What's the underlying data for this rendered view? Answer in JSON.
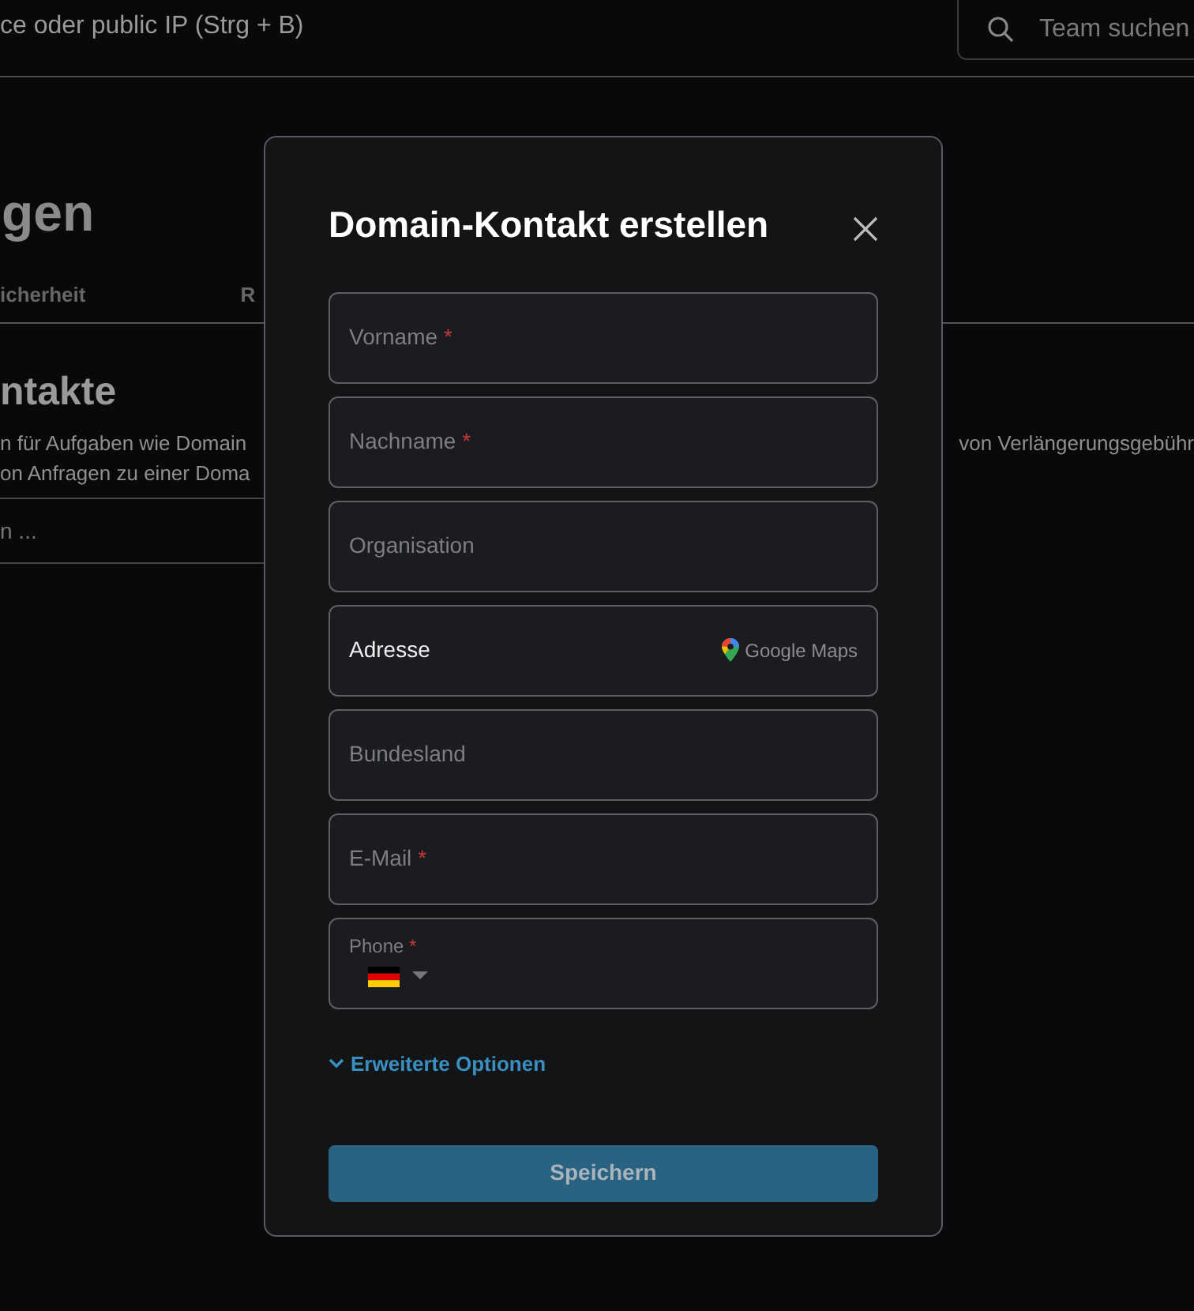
{
  "top_bar": {
    "search_text": "ce oder public IP (Strg + B)",
    "team_search": {
      "placeholder": "Team suchen"
    }
  },
  "page": {
    "title": "gen",
    "tabs": [
      {
        "label": "icherheit"
      },
      {
        "label": "R"
      }
    ],
    "section_title": "ntakte",
    "description_lines": [
      {
        "left": "n für Aufgaben wie Domain",
        "right": "von Verlängerungsgebühr"
      },
      {
        "left": "on Anfragen zu einer Doma"
      }
    ],
    "search": {
      "placeholder": "n ..."
    }
  },
  "dialog": {
    "title": "Domain-Kontakt erstellen",
    "fields": [
      {
        "kind": "text",
        "label": "Vorname",
        "mark": "*"
      },
      {
        "kind": "text",
        "label": "Nachname",
        "mark": "*"
      },
      {
        "kind": "text",
        "label": "Organisation"
      },
      {
        "kind": "address",
        "label": "Adresse",
        "provider": "Google Maps"
      },
      {
        "kind": "text",
        "label": "Bundesland"
      },
      {
        "kind": "text",
        "label": "E-Mail",
        "mark": "*"
      },
      {
        "kind": "phone",
        "label": "Phone",
        "mark": "*"
      }
    ],
    "advanced_link": "Erweiterte Optionen",
    "save_button": "Speichern"
  }
}
